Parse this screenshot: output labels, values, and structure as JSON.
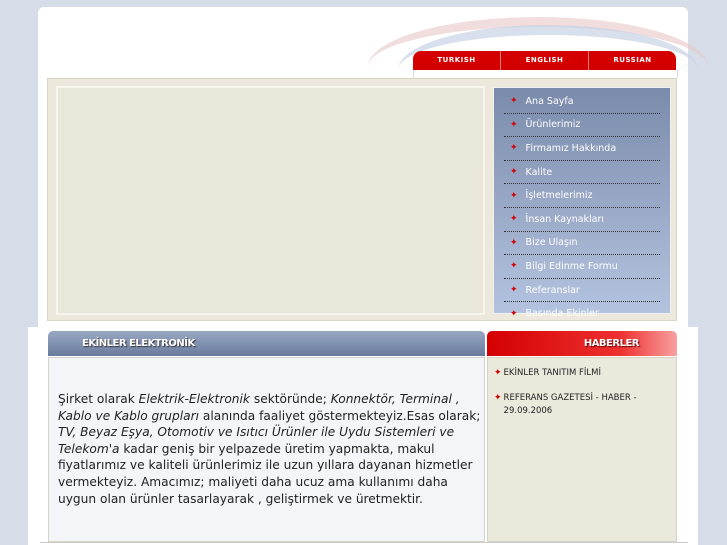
{
  "language_tabs": [
    "TURKISH",
    "ENGLISH",
    "RUSSIAN"
  ],
  "menu": [
    "Ana Sayfa",
    "Ürünlerimiz",
    "Firmamız Hakkında",
    "Kalite",
    "İşletmelerimiz",
    "İnsan Kaynakları",
    "Bize Ulaşın",
    "Bilgi Edinme Formu",
    "Referanslar",
    "Basında Ekinler"
  ],
  "about": {
    "title": "EKİNLER ELEKTRONİK",
    "paragraph": [
      {
        "text": "Şirket olarak ",
        "italic": false
      },
      {
        "text": "Elektrik-Elektronik",
        "italic": true
      },
      {
        "text": " sektöründe; ",
        "italic": false
      },
      {
        "text": "Konnektör, Terminal , Kablo ve Kablo grupları",
        "italic": true
      },
      {
        "text": " alanında faaliyet göstermekteyiz.Esas olarak; ",
        "italic": false
      },
      {
        "text": "TV, Beyaz Eşya, Otomotiv ve Isıtıcı Ürünler ile Uydu Sistemleri ve Telekom'a",
        "italic": true
      },
      {
        "text": " kadar geniş bir yelpazede üretim yapmakta, makul fiyatlarımız ve kaliteli ürünlerimiz ile  uzun yıllara dayanan hizmetler vermekteyiz. Amacımız; maliyeti daha ucuz ama kullanımı daha uygun olan ürünler tasarlayarak , geliştirmek ve üretmektir.",
        "italic": false
      }
    ]
  },
  "news": {
    "title": "HABERLER",
    "items": [
      "EKİNLER TANITIM FİLMİ",
      "REFERANS GAZETESİ - HABER - 29.09.2006"
    ]
  },
  "colors": {
    "red": "#d40000",
    "menu_top": "#7b8bab",
    "menu_bottom": "#b3c3df"
  }
}
